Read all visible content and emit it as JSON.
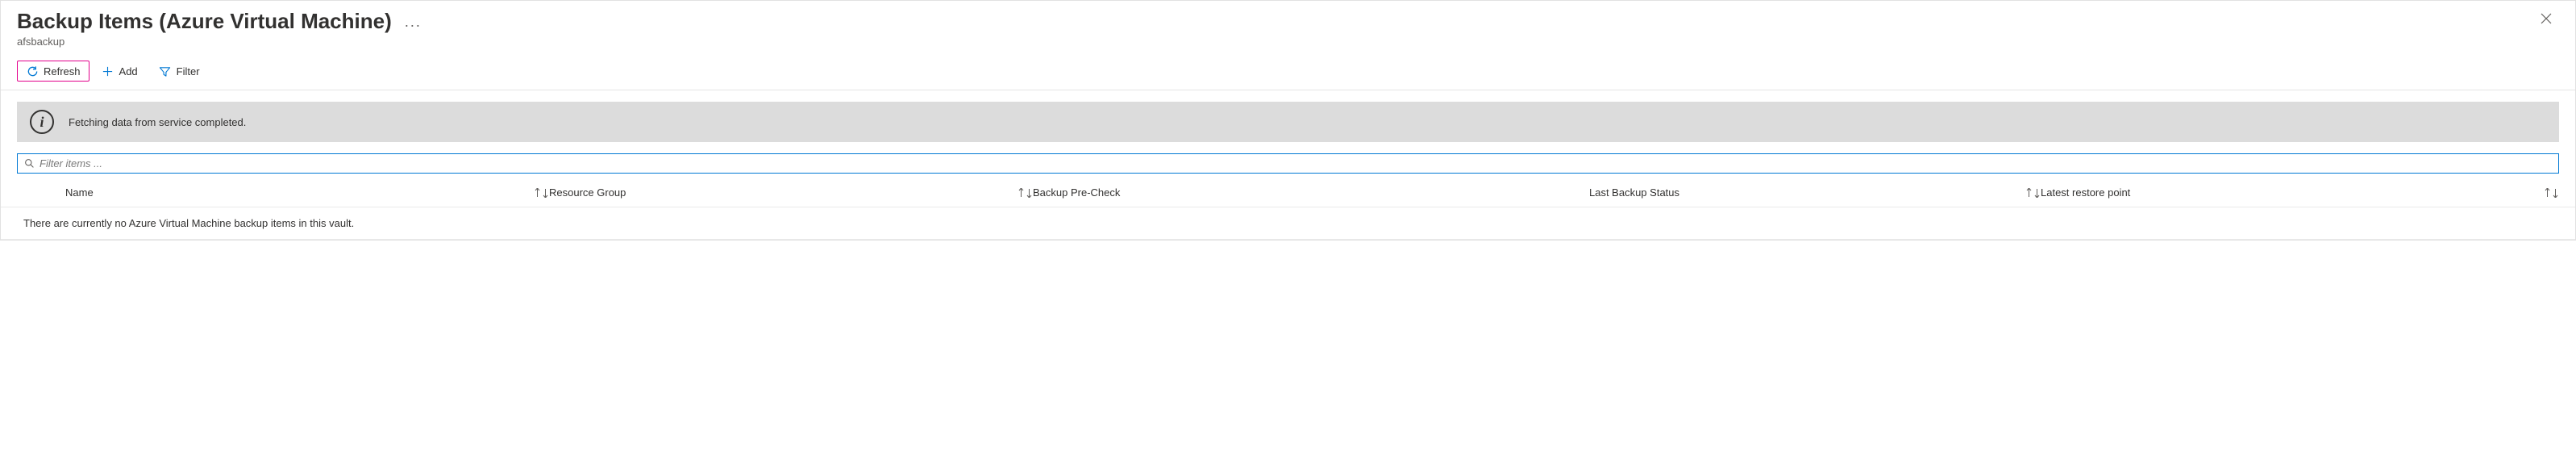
{
  "header": {
    "title": "Backup Items (Azure Virtual Machine)",
    "subtitle": "afsbackup",
    "more_label": "···",
    "close_label": "✕"
  },
  "toolbar": {
    "refresh_label": "Refresh",
    "add_label": "Add",
    "filter_label": "Filter"
  },
  "info": {
    "message": "Fetching data from service completed."
  },
  "filter": {
    "placeholder": "Filter items ..."
  },
  "table": {
    "columns": {
      "name": "Name",
      "resource_group": "Resource Group",
      "backup_pre_check": "Backup Pre-Check",
      "last_backup_status": "Last Backup Status",
      "latest_restore_point": "Latest restore point"
    },
    "empty_message": "There are currently no Azure Virtual Machine backup items in this vault."
  }
}
